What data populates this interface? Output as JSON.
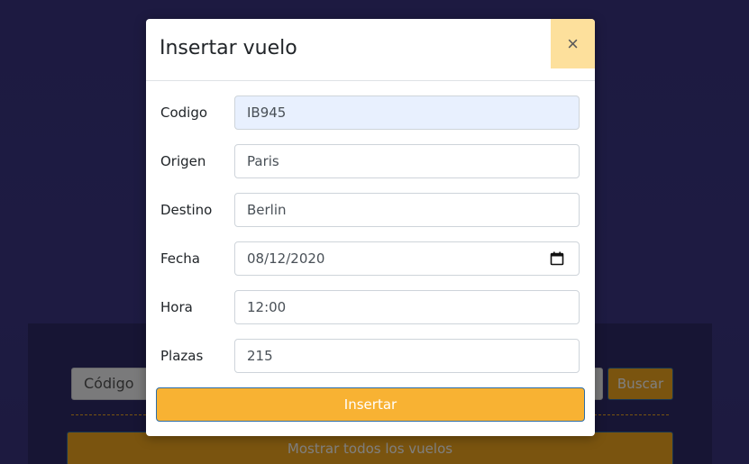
{
  "background": {
    "search_placeholder": "Código",
    "search_button": "Buscar",
    "show_all_button": "Mostrar todos los vuelos"
  },
  "modal": {
    "title": "Insertar vuelo",
    "close_symbol": "×",
    "fields": [
      {
        "label": "Codigo",
        "value": "IB945"
      },
      {
        "label": "Origen",
        "value": "Paris"
      },
      {
        "label": "Destino",
        "value": "Berlin"
      },
      {
        "label": "Fecha",
        "value": "08/12/2020"
      },
      {
        "label": "Hora",
        "value": "12:00"
      },
      {
        "label": "Plazas",
        "value": "215"
      }
    ],
    "submit_label": "Insertar"
  },
  "colors": {
    "accent": "#f8b233",
    "close_button_bg": "#fde09c",
    "background": "#3a3582"
  },
  "icons": {
    "date_picker": "calendar-icon",
    "close": "close-icon"
  }
}
